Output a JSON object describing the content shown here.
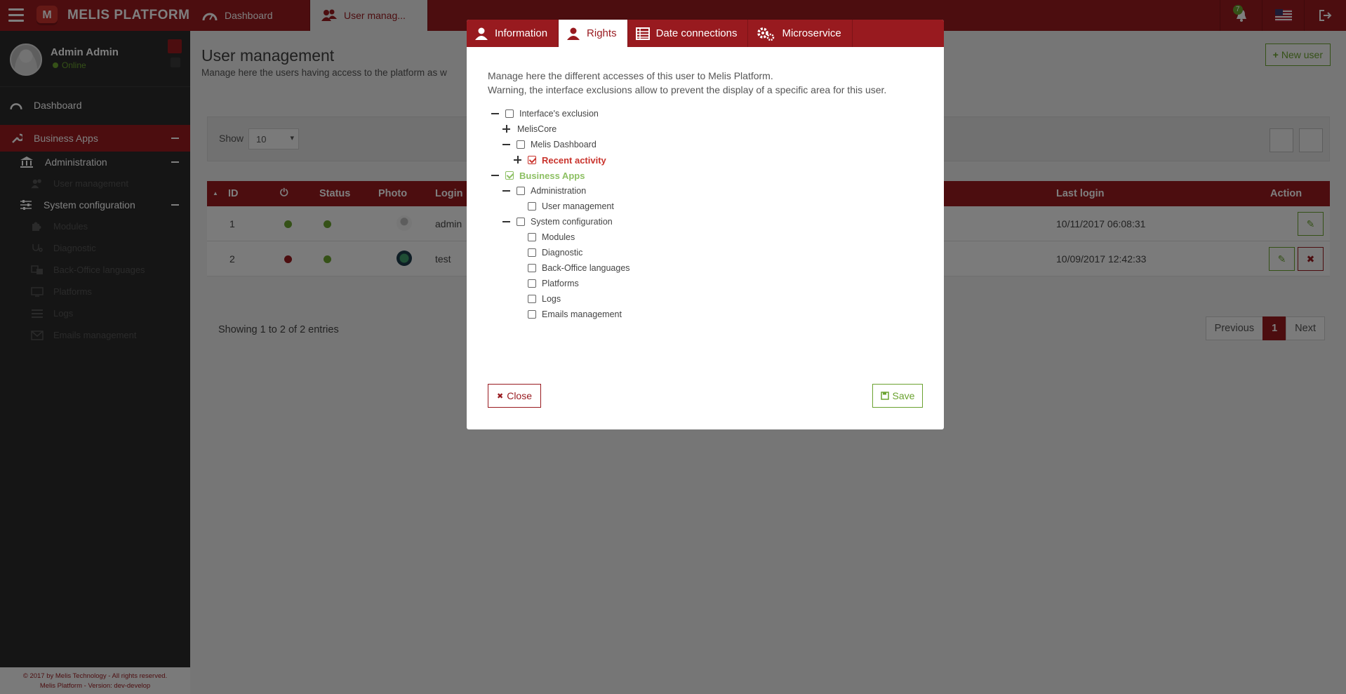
{
  "app": {
    "brand": "MELIS PLATFORM",
    "logo_letter": "M"
  },
  "topbar": {
    "tabs": [
      {
        "label": "Dashboard",
        "icon": "dashboard-icon"
      },
      {
        "label": "User manag...",
        "icon": "users-icon"
      }
    ],
    "notification_count": "7"
  },
  "sidebar": {
    "user_name": "Admin Admin",
    "user_status": "Online",
    "items": {
      "dashboard": "Dashboard",
      "business_apps": "Business Apps",
      "administration": "Administration",
      "user_management": "User management",
      "system_configuration": "System configuration",
      "modules": "Modules",
      "diagnostic": "Diagnostic",
      "backoffice_languages": "Back-Office languages",
      "platforms": "Platforms",
      "logs": "Logs",
      "emails_management": "Emails management"
    },
    "footer_line1": "© 2017 by Melis Technology - All rights reserved.",
    "footer_line2": "Melis Platform - Version: dev-develop"
  },
  "main": {
    "title": "User management",
    "subtitle": "Manage here the users having access to the platform as w",
    "new_user_label": "New user",
    "show_label": "Show",
    "show_value": "10",
    "columns": {
      "id": "ID",
      "status": "Status",
      "photo": "Photo",
      "login": "Login",
      "last_login": "Last login",
      "action": "Action"
    },
    "rows": [
      {
        "id": "1",
        "login": "admin",
        "last_login": "10/11/2017 06:08:31"
      },
      {
        "id": "2",
        "login": "test",
        "last_login": "10/09/2017 12:42:33"
      }
    ],
    "showing_text": "Showing 1 to 2 of 2 entries",
    "pager": {
      "previous": "Previous",
      "current": "1",
      "next": "Next"
    }
  },
  "modal": {
    "tabs": {
      "information": "Information",
      "rights": "Rights",
      "date_connections": "Date connections",
      "microservice": "Microservice"
    },
    "desc_line1": "Manage here the different accesses of this user to Melis Platform.",
    "desc_line2": "Warning, the interface exclusions allow to prevent the display of a specific area for this user.",
    "tree": {
      "interface_exclusion": "Interface's exclusion",
      "meliscore": "MelisCore",
      "melis_dashboard": "Melis Dashboard",
      "recent_activity": "Recent activity",
      "business_apps": "Business Apps",
      "administration": "Administration",
      "user_management": "User management",
      "system_configuration": "System configuration",
      "modules": "Modules",
      "diagnostic": "Diagnostic",
      "backoffice_languages": "Back-Office languages",
      "platforms": "Platforms",
      "logs": "Logs",
      "emails_management": "Emails management"
    },
    "close_label": "Close",
    "save_label": "Save"
  }
}
